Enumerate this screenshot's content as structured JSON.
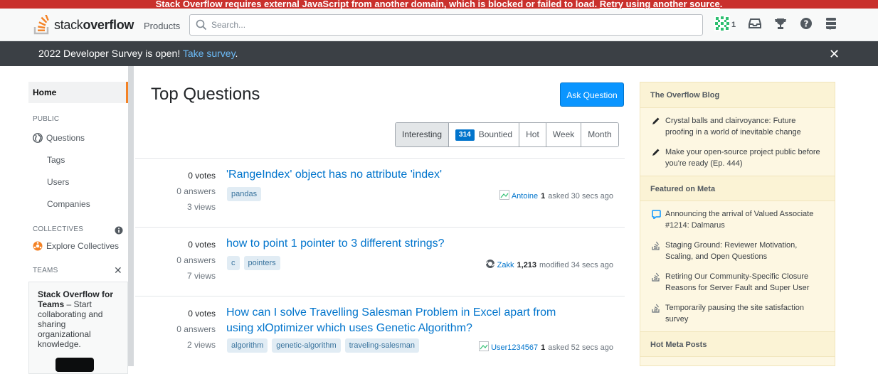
{
  "warning": {
    "text": "Stack Overflow requires external JavaScript from another domain, which is blocked or failed to load. ",
    "link": "Retry using another source",
    "end": "."
  },
  "topbar": {
    "logo_light": "stack",
    "logo_bold": "overflow",
    "products": "Products",
    "search_placeholder": "Search...",
    "reputation": "1"
  },
  "banner": {
    "text": "2022 Developer Survey is open! ",
    "link": "Take survey",
    "end": ".",
    "close": "✕"
  },
  "leftnav": {
    "home": "Home",
    "public": "PUBLIC",
    "questions": "Questions",
    "tags": "Tags",
    "users": "Users",
    "companies": "Companies",
    "collectives": "COLLECTIVES",
    "explore": "Explore Collectives",
    "teams": "TEAMS",
    "teams_close": "✕",
    "teams_title": "Stack Overflow for Teams",
    "teams_desc": " – Start collaborating and sharing organizational knowledge."
  },
  "main": {
    "title": "Top Questions",
    "ask_button": "Ask Question",
    "filters": {
      "interesting": "Interesting",
      "bounty_count": "314",
      "bountied": "Bountied",
      "hot": "Hot",
      "week": "Week",
      "month": "Month"
    },
    "questions": [
      {
        "votes": "0 votes",
        "answers": "0 answers",
        "views": "3 views",
        "title": "'RangeIndex' object has no attribute 'index'",
        "tags": [
          "pandas"
        ],
        "user": "Antoine",
        "rep": "1",
        "action": "asked 30 secs ago"
      },
      {
        "votes": "0 votes",
        "answers": "0 answers",
        "views": "7 views",
        "title": "how to point 1 pointer to 3 different strings?",
        "tags": [
          "c",
          "pointers"
        ],
        "user": "Zakk",
        "rep": "1,213",
        "action": "modified 34 secs ago"
      },
      {
        "votes": "0 votes",
        "answers": "0 answers",
        "views": "2 views",
        "title": "How can I solve Travelling Salesman Problem in Excel apart from using xlOptimizer which uses Genetic Algorithm?",
        "tags": [
          "algorithm",
          "genetic-algorithm",
          "traveling-salesman"
        ],
        "user": "User1234567",
        "rep": "1",
        "action": "asked 52 secs ago"
      }
    ]
  },
  "right": {
    "blog_head": "The Overflow Blog",
    "blog": [
      "Crystal balls and clairvoyance: Future proofing in a world of inevitable change",
      "Make your open-source project public before you're ready (Ep. 444)"
    ],
    "meta_head": "Featured on Meta",
    "meta": [
      "Announcing the arrival of Valued Associate #1214: Dalmarus",
      "Staging Ground: Reviewer Motivation, Scaling, and Open Questions",
      "Retiring Our Community-Specific Closure Reasons for Server Fault and Super User",
      "Temporarily pausing the site satisfaction survey"
    ],
    "hot_head": "Hot Meta Posts"
  },
  "colors": {
    "accent": "#0a95ff",
    "link": "#0074cc",
    "warning": "#c9302c",
    "orange": "#f48225"
  }
}
